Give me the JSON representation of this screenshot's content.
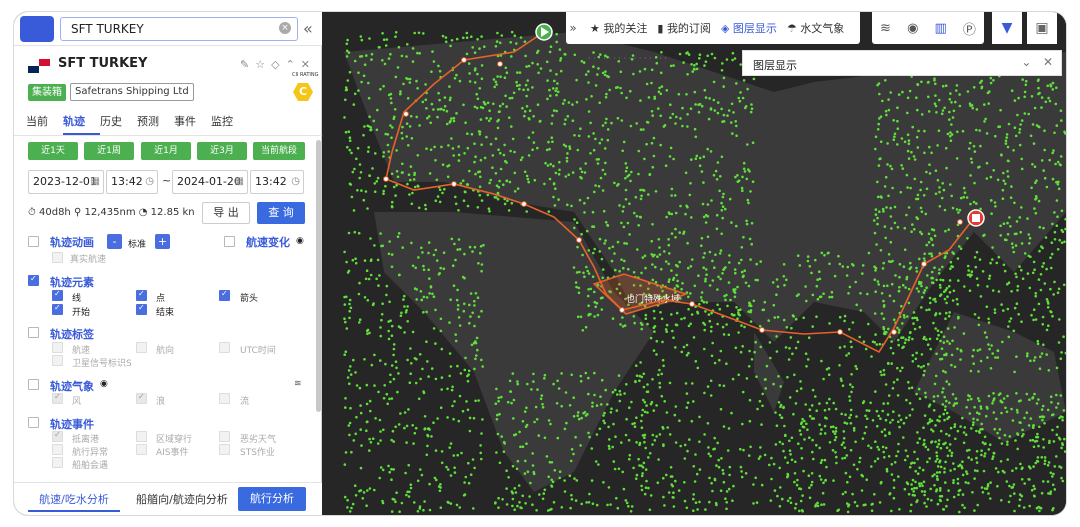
{
  "search": {
    "value": "SFT TURKEY",
    "clear_icon": "clear-icon",
    "collapse_icon": "collapse-left-icon"
  },
  "vessel": {
    "name": "SFT TURKEY",
    "type_tag": "集装箱",
    "company": "Safetrans Shipping Ltd",
    "cii_label": "CII RATING",
    "cii_grade": "C",
    "header_icons": [
      "edit-icon",
      "star-icon",
      "locate-icon",
      "collapse-up-icon",
      "close-icon"
    ]
  },
  "tabs": [
    "当前",
    "轨迹",
    "历史",
    "预测",
    "事件",
    "监控"
  ],
  "active_tab": "轨迹",
  "quick_ranges": [
    "近1天",
    "近1周",
    "近1月",
    "近3月",
    "当前航段"
  ],
  "date_range": {
    "start_date": "2023-12-01",
    "start_time": "13:42",
    "separator": "~",
    "end_date": "2024-01-20",
    "end_time": "13:42"
  },
  "stats": {
    "duration": "40d8h",
    "distance": "12,435nm",
    "speed": "12.85 kn"
  },
  "buttons": {
    "export": "导 出",
    "query": "查 询"
  },
  "track_animation": {
    "label": "轨迹动画",
    "minus": "-",
    "speed": "标准",
    "plus": "+",
    "real_speed": "真实航速"
  },
  "speed_change": {
    "label": "航速变化"
  },
  "track_elements": {
    "label": "轨迹元素",
    "items": [
      "线",
      "点",
      "箭头",
      "开始",
      "结束"
    ]
  },
  "track_labels": {
    "label": "轨迹标签",
    "items": [
      "航速",
      "航向",
      "UTC时间",
      "卫星信号标识S"
    ]
  },
  "track_weather": {
    "label": "轨迹气象",
    "items": [
      "风",
      "浪",
      "流"
    ]
  },
  "track_events": {
    "label": "轨迹事件",
    "items": [
      "抵离港",
      "区域穿行",
      "恶劣天气",
      "航行异常",
      "AIS事件",
      "STS作业",
      "船舶会遇"
    ]
  },
  "bottom_tabs": [
    "航速/吃水分析",
    "船艏向/航迹向分析",
    "航行分析"
  ],
  "toolbar": {
    "items": [
      "我的关注",
      "我的订阅",
      "图层显示",
      "水文气象"
    ],
    "active": "图层显示"
  },
  "layer_panel": {
    "title": "图层显示"
  },
  "map": {
    "area_label": "也门特殊水域",
    "colors": {
      "land": "#3b3b3b",
      "sea": "#2a2a2a",
      "ship": "#5fe03a",
      "track": "#e8622a",
      "accent": "#3a5bd9"
    }
  }
}
